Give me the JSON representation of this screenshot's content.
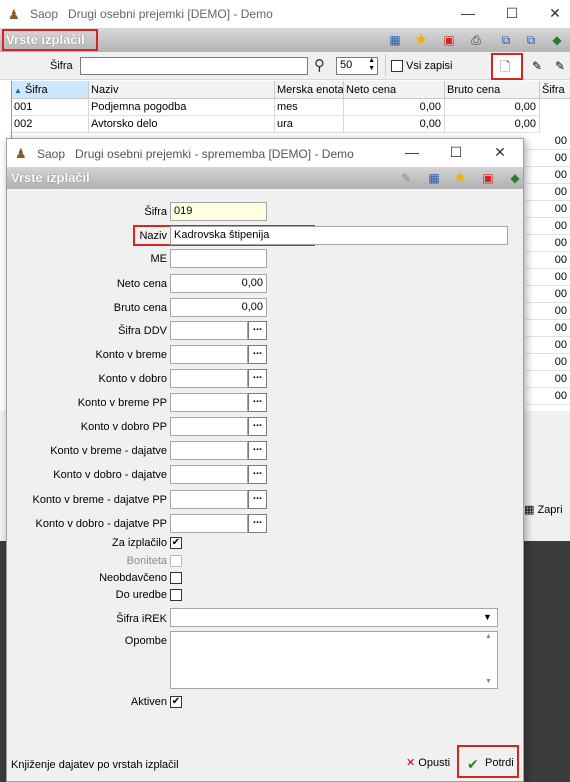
{
  "main_window": {
    "app": "Saop",
    "title": "Drugi osebni prejemki [DEMO] - Demo",
    "header_title": "Vrste izplačil",
    "search_label": "Šifra",
    "search_value": "",
    "page_size": "50",
    "all_records_label": "Vsi zapisi",
    "columns": [
      "Šifra",
      "Naziv",
      "Merska enota",
      "Neto cena",
      "Bruto cena",
      "Šifra"
    ],
    "rows": [
      [
        "001",
        "Podjemna pogodba",
        "mes",
        "0,00",
        "0,00",
        ""
      ],
      [
        "002",
        "Avtorsko delo",
        "ura",
        "0,00",
        "0,00",
        ""
      ]
    ],
    "hidden_cell_values": [
      "00",
      "00",
      "00",
      "00",
      "00",
      "00",
      "00",
      "00",
      "00",
      "00",
      "00",
      "00",
      "00",
      "00",
      "00",
      "00"
    ],
    "close_btn_label": "Zapri"
  },
  "dialog": {
    "app": "Saop",
    "title": "Drugi osebni prejemki - sprememba [DEMO] - Demo",
    "header_title": "Vrste izplačil",
    "fields": {
      "sifra": {
        "label": "Šifra",
        "value": "019"
      },
      "naziv": {
        "label": "Naziv",
        "value": "Kadrovska štipenija"
      },
      "me": {
        "label": "ME",
        "value": ""
      },
      "neto": {
        "label": "Neto cena",
        "value": "0,00"
      },
      "bruto": {
        "label": "Bruto cena",
        "value": "0,00"
      },
      "sifra_ddv": {
        "label": "Šifra DDV",
        "value": ""
      },
      "konto_breme": {
        "label": "Konto v breme",
        "value": ""
      },
      "konto_dobro": {
        "label": "Konto v dobro",
        "value": ""
      },
      "konto_breme_pp": {
        "label": "Konto v breme PP",
        "value": ""
      },
      "konto_dobro_pp": {
        "label": "Konto v dobro PP",
        "value": ""
      },
      "konto_breme_daj": {
        "label": "Konto v breme - dajatve",
        "value": ""
      },
      "konto_dobro_daj": {
        "label": "Konto v dobro - dajatve",
        "value": ""
      },
      "konto_breme_daj_pp": {
        "label": "Konto v breme - dajatve PP",
        "value": ""
      },
      "konto_dobro_daj_pp": {
        "label": "Konto v dobro - dajatve PP",
        "value": ""
      }
    },
    "checks": {
      "za_izplacilo": {
        "label": "Za izplačilo",
        "checked": true
      },
      "boniteta": {
        "label": "Boniteta",
        "checked": false
      },
      "neobdavceno": {
        "label": "Neobdavčeno",
        "checked": false
      },
      "do_uredbe": {
        "label": "Do uredbe",
        "checked": false
      },
      "aktiven": {
        "label": "Aktiven",
        "checked": true
      }
    },
    "sifra_irek_label": "Šifra iREK",
    "sifra_irek_value": "",
    "opombe_label": "Opombe",
    "opombe_value": "",
    "link_text": "Knjiženje dajatev po vrstah izplačil",
    "cancel_label": "Opusti",
    "confirm_label": "Potrdi",
    "check_glyph": "✔"
  },
  "colors": {
    "highlight": "#d9231f",
    "header_gradient": "#b4b4b4"
  }
}
